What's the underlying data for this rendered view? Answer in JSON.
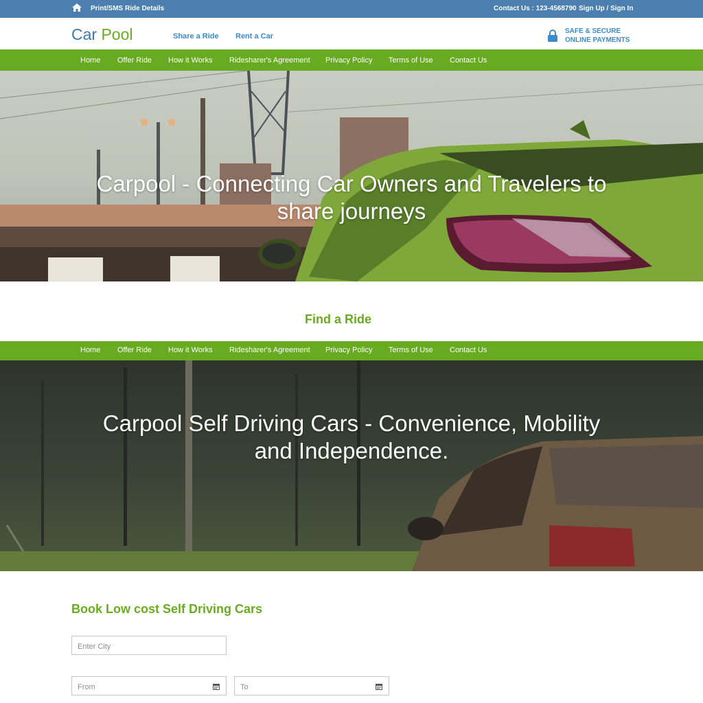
{
  "topbar": {
    "print_link": "Print/SMS Ride Details",
    "contact": "Contact Us : 123-4568790",
    "signin": "Sign Up / Sign In",
    "background": "#4a7fb0"
  },
  "header": {
    "brand_car": "Car",
    "brand_pool": "Pool",
    "links": [
      "Share a Ride",
      "Rent a Car"
    ],
    "secure_line1": "SAFE & SECURE",
    "secure_line2": "ONLINE PAYMENTS",
    "icons": {
      "home": "home-icon",
      "lock": "lock-icon"
    }
  },
  "nav": {
    "items": [
      "Home",
      "Offer Ride",
      "How it Works",
      "Ridesharer's Agreement",
      "Privacy Policy",
      "Terms of Use",
      "Contact Us"
    ],
    "background": "#68ab22"
  },
  "hero1": {
    "title_line1": "Carpool - Connecting Car Owners and Travelers to",
    "title_line2": "share journeys"
  },
  "find_ride": "Find a Ride",
  "hero2": {
    "title_line1": "Carpool Self Driving Cars - Convenience, Mobility",
    "title_line2": "and Independence."
  },
  "booking": {
    "title": "Book Low cost Self Driving Cars",
    "city_placeholder": "Enter City",
    "from_placeholder": "From",
    "to_placeholder": "To",
    "accent": "#6aac1f"
  }
}
